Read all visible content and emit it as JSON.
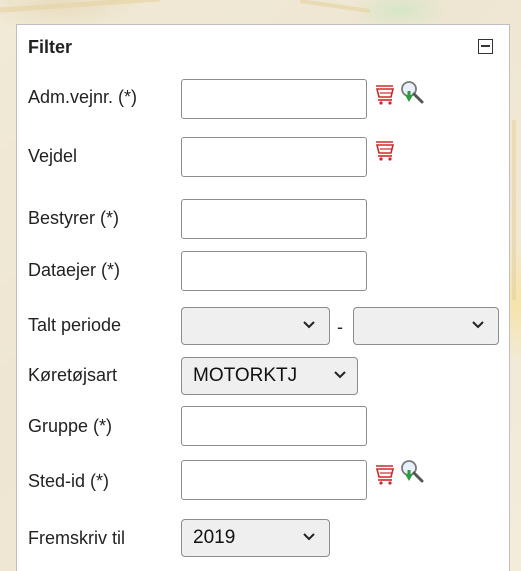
{
  "filter_panel": {
    "title": "Filter",
    "rows": {
      "adm_vejnr": {
        "label": "Adm.vejnr. (*)",
        "value": ""
      },
      "vejdel": {
        "label": "Vejdel",
        "value": ""
      },
      "bestyrer": {
        "label": "Bestyrer (*)",
        "value": ""
      },
      "dataejer": {
        "label": "Dataejer (*)",
        "value": ""
      },
      "talt_periode": {
        "label": "Talt periode",
        "from": "",
        "separator": "-",
        "to": ""
      },
      "koretojsart": {
        "label": "Køretøjsart",
        "selected": "MOTORKTJ"
      },
      "gruppe": {
        "label": "Gruppe (*)",
        "value": ""
      },
      "sted_id": {
        "label": "Sted-id (*)",
        "value": ""
      },
      "fremskriv_til": {
        "label": "Fremskriv til",
        "selected": "2019"
      }
    }
  },
  "icons": {
    "collapse": "minus-square-icon",
    "cart": "shopping-cart-icon",
    "search": "magnifier-download-icon"
  },
  "colors": {
    "cart_red": "#cc2a2a",
    "search_green": "#2e9a3e",
    "search_blue": "#3e7fc4",
    "select_bg": "#efefef",
    "input_border": "#8c8c8c"
  }
}
